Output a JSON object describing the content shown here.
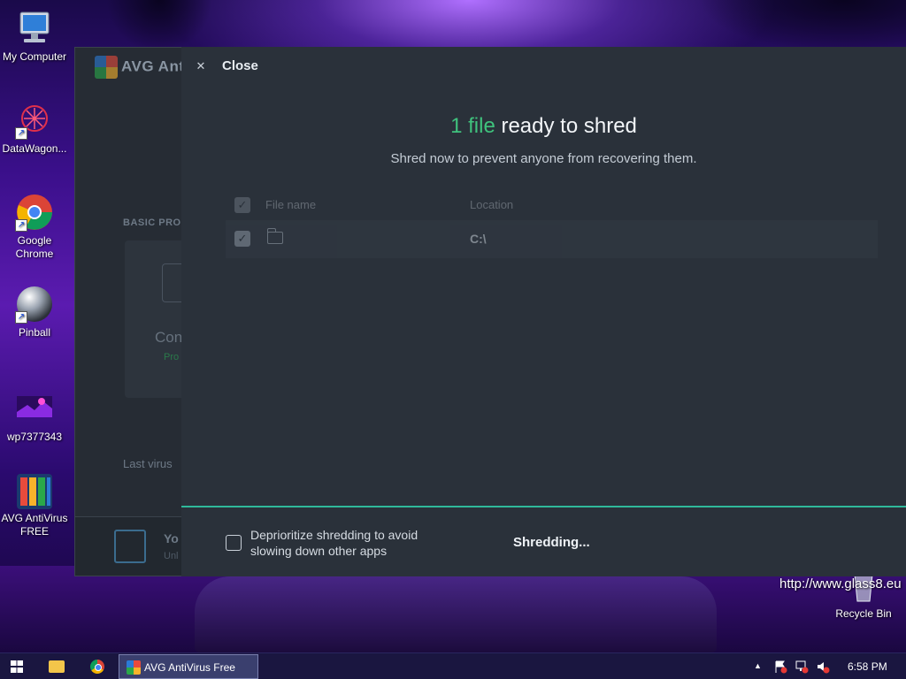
{
  "desktop": {
    "icons": [
      {
        "label": "My Computer"
      },
      {
        "label": "DataWagon..."
      },
      {
        "label": "Google Chrome"
      },
      {
        "label": "Pinball"
      },
      {
        "label": "wp7377343"
      },
      {
        "label": "AVG AntiVirus FREE"
      },
      {
        "label": "Recycle Bin"
      }
    ],
    "watermark": "http://www.glass8.eu"
  },
  "avg_window": {
    "brand": "AVG Ant",
    "basic_label": "BASIC PRO",
    "card_title": "Con",
    "card_status": "Pro",
    "last_virus": "Last virus",
    "footer_title": "Yo",
    "footer_sub": "Unl"
  },
  "shredder": {
    "close_label": "Close",
    "headline_count": "1 file",
    "headline_rest": " ready to shred",
    "subtitle": "Shred now to prevent anyone from recovering them.",
    "columns": {
      "file_name": "File name",
      "location": "Location"
    },
    "rows": [
      {
        "file_name": "",
        "location": "C:\\"
      }
    ],
    "deprioritize_label": "Deprioritize shredding to avoid slowing down other apps",
    "status": "Shredding..."
  },
  "taskbar": {
    "active_task": "AVG AntiVirus Free",
    "clock": "6:58 PM",
    "tray_up_arrow": "▲"
  },
  "colors": {
    "accent_green": "#3fc27d",
    "divider_teal": "#2fb99a",
    "panel_bg": "#2a313a"
  }
}
